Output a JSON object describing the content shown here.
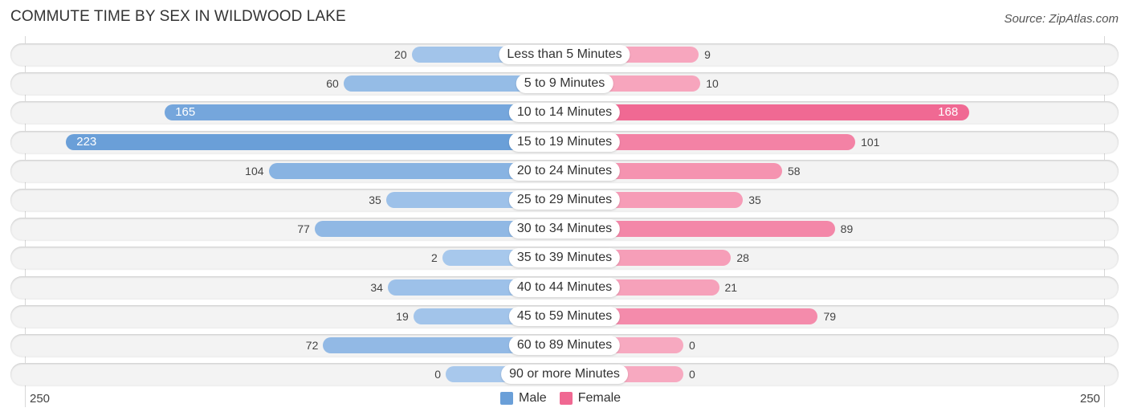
{
  "header": {
    "title": "COMMUTE TIME BY SEX IN WILDWOOD LAKE",
    "source": "Source: ZipAtlas.com"
  },
  "colors": {
    "male": "#6a9fd8",
    "male_light": "#a8c8ec",
    "female": "#f06892",
    "female_light": "#f7a9c0"
  },
  "chart_data": {
    "type": "bar",
    "orientation": "horizontal-diverging",
    "title": "COMMUTE TIME BY SEX IN WILDWOOD LAKE",
    "categories": [
      "Less than 5 Minutes",
      "5 to 9 Minutes",
      "10 to 14 Minutes",
      "15 to 19 Minutes",
      "20 to 24 Minutes",
      "25 to 29 Minutes",
      "30 to 34 Minutes",
      "35 to 39 Minutes",
      "40 to 44 Minutes",
      "45 to 59 Minutes",
      "60 to 89 Minutes",
      "90 or more Minutes"
    ],
    "series": [
      {
        "name": "Male",
        "values": [
          20,
          60,
          165,
          223,
          104,
          35,
          77,
          2,
          34,
          19,
          72,
          0
        ]
      },
      {
        "name": "Female",
        "values": [
          9,
          10,
          168,
          101,
          58,
          35,
          89,
          28,
          21,
          79,
          0,
          0
        ]
      }
    ],
    "axis": {
      "left_label": "250",
      "right_label": "250",
      "max": 250
    },
    "legend": {
      "position": "bottom-center",
      "items": [
        "Male",
        "Female"
      ]
    }
  }
}
